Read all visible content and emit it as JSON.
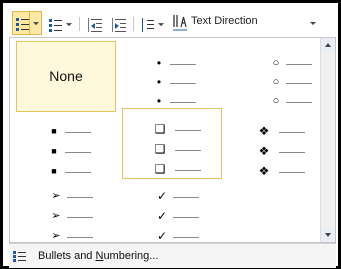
{
  "toolbar": {
    "text_direction_label": "Text Direction",
    "icons": {
      "bullets": "bullets-icon",
      "numbering": "numbering-icon",
      "decrease_indent": "decrease-indent-icon",
      "increase_indent": "increase-indent-icon",
      "line_spacing": "line-spacing-icon",
      "text_direction": "text-direction-icon"
    }
  },
  "gallery": {
    "none_label": "None",
    "cells": [
      {
        "id": "none",
        "glyph": ""
      },
      {
        "id": "filled-round",
        "glyph": "•"
      },
      {
        "id": "hollow-round",
        "glyph": "○"
      },
      {
        "id": "filled-square",
        "glyph": "■"
      },
      {
        "id": "hollow-square",
        "glyph": "❑"
      },
      {
        "id": "four-diamond",
        "glyph": "❖"
      },
      {
        "id": "arrowhead",
        "glyph": "➢"
      },
      {
        "id": "checkmark",
        "glyph": "✓"
      }
    ],
    "selected": "none"
  },
  "footer": {
    "label_before": "Bullets and ",
    "label_underlined": "N",
    "label_after": "umbering..."
  },
  "colors": {
    "accent_highlight": "#fde9a6",
    "accent_border": "#e3b546",
    "bullet_blue": "#1e5aa8"
  }
}
